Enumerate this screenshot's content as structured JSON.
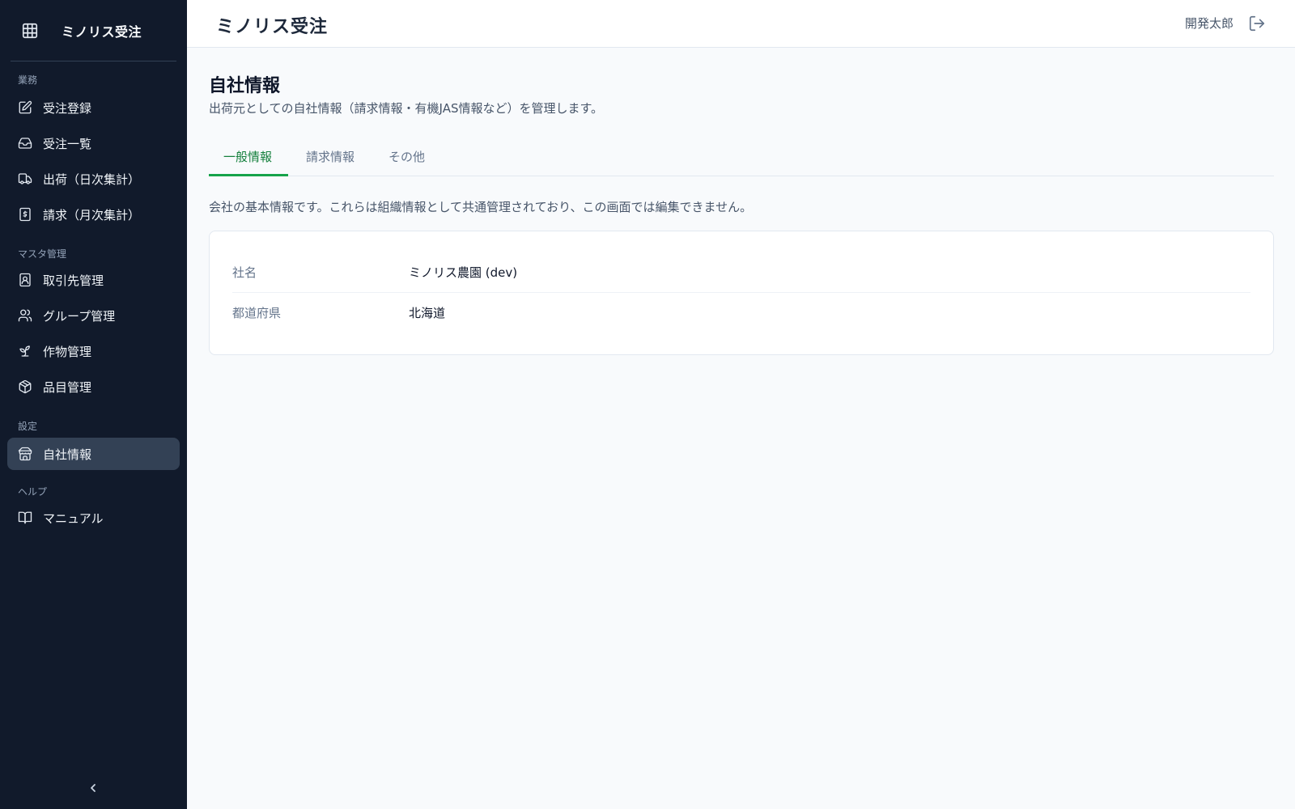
{
  "sidebar": {
    "brand_title": "ミノリス受注",
    "sections": [
      {
        "label": "業務"
      },
      {
        "label": "マスタ管理"
      },
      {
        "label": "設定"
      },
      {
        "label": "ヘルプ"
      }
    ],
    "items": [
      {
        "label": "受注登録",
        "icon": "edit-icon"
      },
      {
        "label": "受注一覧",
        "icon": "inbox-icon"
      },
      {
        "label": "出荷（日次集計）",
        "icon": "truck-icon"
      },
      {
        "label": "請求（月次集計）",
        "icon": "receipt-icon"
      },
      {
        "label": "取引先管理",
        "icon": "contact-icon"
      },
      {
        "label": "グループ管理",
        "icon": "users-icon"
      },
      {
        "label": "作物管理",
        "icon": "sprout-icon"
      },
      {
        "label": "品目管理",
        "icon": "package-icon"
      },
      {
        "label": "自社情報",
        "icon": "store-icon",
        "active": true
      },
      {
        "label": "マニュアル",
        "icon": "book-icon"
      }
    ]
  },
  "header": {
    "title": "ミノリス受注",
    "user_name": "開発太郎"
  },
  "main": {
    "title": "自社情報",
    "description": "出荷元としての自社情報（請求情報・有機JAS情報など）を管理します。",
    "tabs": [
      {
        "label": "一般情報",
        "active": true
      },
      {
        "label": "請求情報"
      },
      {
        "label": "その他"
      }
    ],
    "info_text": "会社の基本情報です。これらは組織情報として共通管理されており、この画面では編集できません。",
    "fields": [
      {
        "label": "社名",
        "value": "ミノリス農園 (dev)"
      },
      {
        "label": "都道府県",
        "value": "北海道"
      }
    ]
  },
  "colors": {
    "sidebar_bg": "#111a2b",
    "active_item_bg": "#334155",
    "accent_green": "#16a34a"
  }
}
